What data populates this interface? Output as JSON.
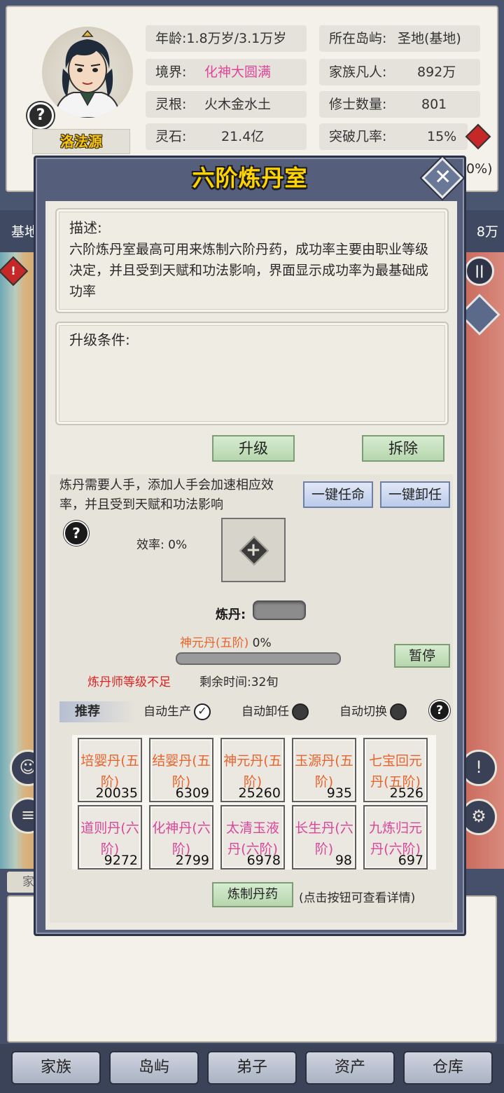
{
  "character": {
    "name": "洛法源",
    "help": "?",
    "age_label": "年龄:",
    "age_value": "1.8万岁/3.1万岁",
    "realm_label": "境界:",
    "realm_value": "化神大圆满",
    "root_label": "灵根:",
    "root_value": "火木金水土",
    "stone_label": "灵石:",
    "stone_value": "21.4亿",
    "island_label": "所在岛屿:",
    "island_value": "圣地(基地)",
    "mortals_label": "家族凡人:",
    "mortals_value": "892万",
    "cultivators_label": "修士数量:",
    "cultivators_value": "801",
    "breakthrough_label": "突破几率:",
    "breakthrough_value": "15%",
    "partial_value": "0%)"
  },
  "map": {
    "left_label": "基地",
    "right_label": "8万",
    "warn_icon": "!",
    "pause_icon": "||"
  },
  "modal": {
    "title": "六阶炼丹室",
    "close_icon": "✕",
    "desc_title": "描述:",
    "desc_text": "六阶炼丹室最高可用来炼制六阶丹药，成功率主要由职业等级决定，并且受到天赋和功法影响，界面显示成功率为最基础成功率",
    "req_title": "升级条件:",
    "upgrade_btn": "升级",
    "demolish_btn": "拆除",
    "work_desc": "炼丹需要人手，添加人手会加速相应效率，并且受到天赋和功法影响",
    "assign_all_btn": "一键任命",
    "dismiss_all_btn": "一键卸任",
    "help": "?",
    "efficiency": "效率: 0%",
    "add_icon": "+",
    "craft_label": "炼丹:",
    "recipe_name": "神元丹(五阶)",
    "recipe_progress_text": " 0%",
    "progress": 0,
    "pause_btn": "暂停",
    "warn_text": "炼丹师等级不足",
    "time_text": "剩余时间:32旬",
    "rec_tag": "推荐",
    "auto_produce": "自动生产",
    "auto_produce_mark": "✓",
    "auto_dismiss": "自动卸任",
    "auto_switch": "自动切换",
    "pills": [
      {
        "name": "培婴丹(五阶)",
        "count": "20035",
        "tier": "five"
      },
      {
        "name": "结婴丹(五阶)",
        "count": "6309",
        "tier": "five"
      },
      {
        "name": "神元丹(五阶)",
        "count": "25260",
        "tier": "five"
      },
      {
        "name": "玉源丹(五阶)",
        "count": "935",
        "tier": "five"
      },
      {
        "name": "七宝回元丹(五阶)",
        "count": "2526",
        "tier": "five"
      },
      {
        "name": "道则丹(六阶)",
        "count": "9272",
        "tier": "six"
      },
      {
        "name": "化神丹(六阶)",
        "count": "2799",
        "tier": "six"
      },
      {
        "name": "太清玉液丹(六阶)",
        "count": "6978",
        "tier": "six"
      },
      {
        "name": "长生丹(六阶)",
        "count": "98",
        "tier": "six"
      },
      {
        "name": "九炼归元丹(六阶)",
        "count": "697",
        "tier": "six"
      }
    ],
    "craft_btn": "炼制丹药",
    "craft_hint": "(点击按钮可查看详情)"
  },
  "bottom": {
    "tab_hint": "家"
  },
  "nav": [
    "家族",
    "岛屿",
    "弟子",
    "资产",
    "仓库"
  ],
  "colors": {
    "title_yellow": "#ffd400",
    "realm_pink": "#e0459a",
    "five_tier": "#e8642d",
    "six_tier": "#d9479a",
    "warning_red": "#d22222"
  }
}
